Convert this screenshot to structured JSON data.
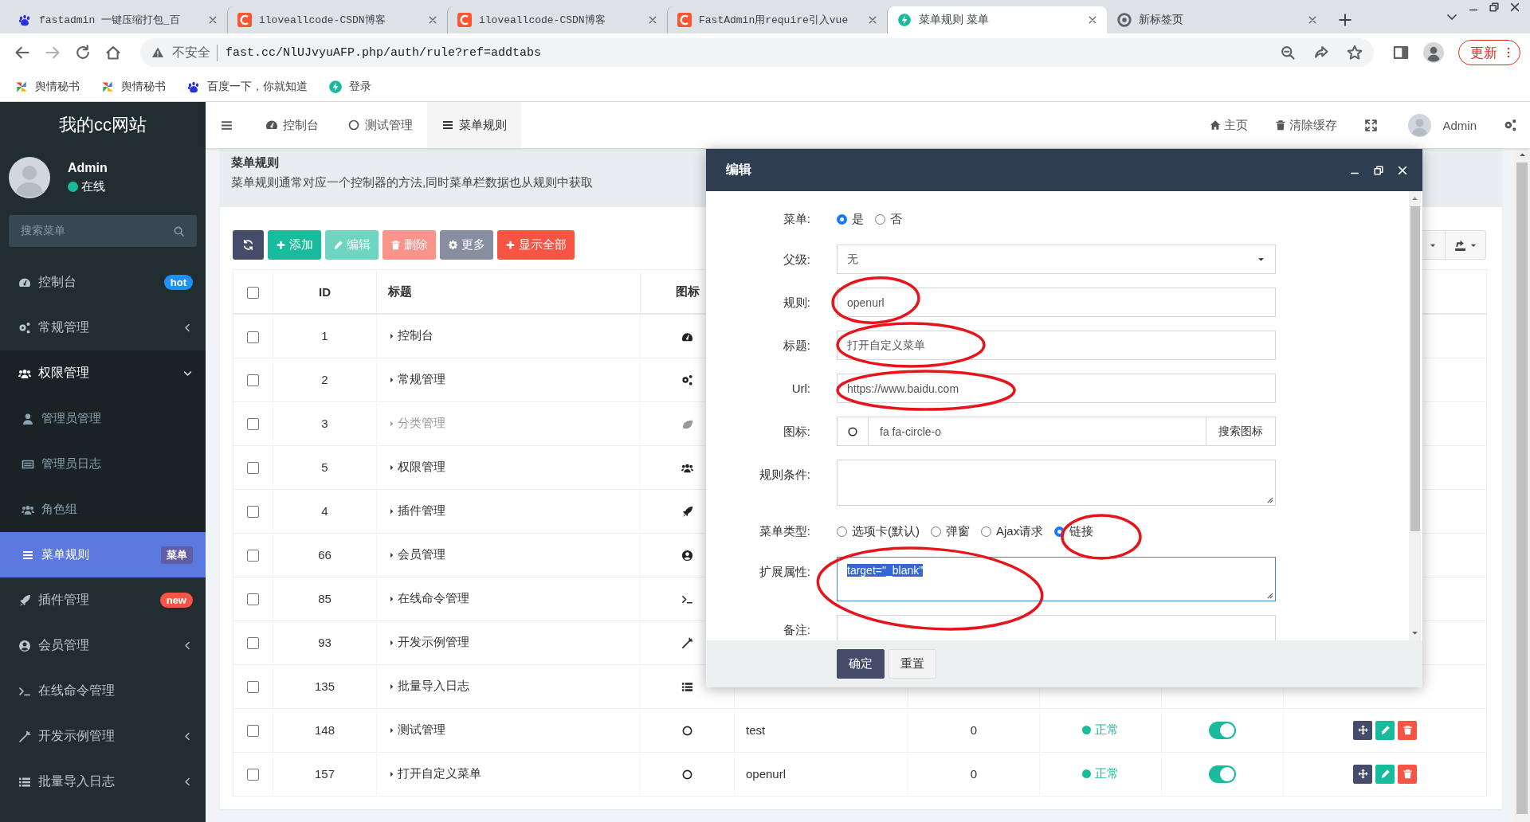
{
  "browser": {
    "tabs": [
      {
        "title": "fastadmin 一键压缩打包_百",
        "selected": false
      },
      {
        "title": "iloveallcode-CSDN博客",
        "selected": false
      },
      {
        "title": "iloveallcode-CSDN博客",
        "selected": false
      },
      {
        "title": "FastAdmin用require引入vue",
        "selected": false
      },
      {
        "title": "菜单规则 菜单",
        "selected": true
      },
      {
        "title": "新标签页",
        "selected": false
      }
    ],
    "security": "不安全",
    "url": "fast.cc/NlUJvyuAFP.php/auth/rule?ref=addtabs",
    "update_button": "更新",
    "bookmarks": [
      "舆情秘书",
      "舆情秘书",
      "百度一下，你就知道",
      "登录"
    ]
  },
  "sidebar": {
    "site_title": "我的cc网站",
    "user": {
      "name": "Admin",
      "status": "在线"
    },
    "search": {
      "placeholder": "搜索菜单"
    },
    "menu": [
      {
        "label": "控制台",
        "selected": false,
        "badge": {
          "text": "hot",
          "color": "#1e90ff"
        }
      },
      {
        "label": "常规管理",
        "selected": false,
        "expanded": false
      },
      {
        "label": "权限管理",
        "selected": false,
        "expanded": true,
        "children": [
          {
            "label": "管理员管理",
            "selected": false
          },
          {
            "label": "管理员日志",
            "selected": false
          },
          {
            "label": "角色组",
            "selected": false
          },
          {
            "label": "菜单规则",
            "selected": true,
            "badge": {
              "text": "菜单",
              "color": "#605ca8"
            }
          }
        ]
      },
      {
        "label": "插件管理",
        "selected": false,
        "badge": {
          "text": "new",
          "color": "#f75444"
        }
      },
      {
        "label": "会员管理",
        "selected": false,
        "expanded": false
      },
      {
        "label": "在线命令管理",
        "selected": false
      },
      {
        "label": "开发示例管理",
        "selected": false,
        "expanded": false
      },
      {
        "label": "批量导入日志",
        "selected": false,
        "expanded": false
      }
    ]
  },
  "navbar": {
    "tabs": [
      {
        "label": "控制台",
        "selected": false
      },
      {
        "label": "测试管理",
        "selected": false
      },
      {
        "label": "菜单规则",
        "selected": true
      }
    ],
    "links": [
      "主页",
      "清除缓存"
    ],
    "user": "Admin"
  },
  "page": {
    "title": "菜单规则",
    "description": "菜单规则通常对应一个控制器的方法,同时菜单栏数据也从规则中获取"
  },
  "toolbar": [
    {
      "kind": "refresh",
      "disabled": false
    },
    {
      "kind": "add",
      "label": "添加",
      "disabled": false
    },
    {
      "kind": "edit",
      "label": "编辑",
      "disabled": true
    },
    {
      "kind": "delete",
      "label": "删除",
      "disabled": true
    },
    {
      "kind": "more",
      "label": "更多",
      "disabled": false
    },
    {
      "kind": "show_all",
      "label": "显示全部",
      "disabled": false
    }
  ],
  "table": {
    "columns": [
      "ID",
      "标题",
      "图标"
    ],
    "header_checked": false,
    "rows": [
      {
        "id": "1",
        "title": "控制台",
        "muted": false,
        "checked": false
      },
      {
        "id": "2",
        "title": "常规管理",
        "muted": false,
        "checked": false
      },
      {
        "id": "3",
        "title": "分类管理",
        "muted": true,
        "checked": false
      },
      {
        "id": "5",
        "title": "权限管理",
        "muted": false,
        "checked": false
      },
      {
        "id": "4",
        "title": "插件管理",
        "muted": false,
        "checked": false
      },
      {
        "id": "66",
        "title": "会员管理",
        "muted": false,
        "checked": false
      },
      {
        "id": "85",
        "title": "在线命令管理",
        "muted": false,
        "checked": false
      },
      {
        "id": "93",
        "title": "开发示例管理",
        "muted": false,
        "checked": false
      },
      {
        "id": "135",
        "title": "批量导入日志",
        "muted": false,
        "checked": false
      },
      {
        "id": "148",
        "title": "测试管理",
        "muted": false,
        "checked": false,
        "rule": "test",
        "weigh": "0",
        "status": {
          "text": "正常",
          "color": "#18bc9c"
        },
        "on": true
      },
      {
        "id": "157",
        "title": "打开自定义菜单",
        "muted": false,
        "checked": false,
        "rule": "openurl",
        "weigh": "0",
        "status": {
          "text": "正常",
          "color": "#18bc9c"
        },
        "on": true
      }
    ]
  },
  "dialog": {
    "title": "编辑",
    "fields": [
      {
        "kind": "radio",
        "label": "菜单:",
        "options": [
          {
            "label": "是",
            "selected": true
          },
          {
            "label": "否",
            "selected": false
          }
        ]
      },
      {
        "kind": "select",
        "label": "父级:",
        "value": "无"
      },
      {
        "kind": "input",
        "label": "规则:",
        "value": "openurl"
      },
      {
        "kind": "input",
        "label": "标题:",
        "value": "打开自定义菜单"
      },
      {
        "kind": "input",
        "label": "Url:",
        "value": "https://www.baidu.com"
      },
      {
        "kind": "icon_input",
        "label": "图标:",
        "value": "fa fa-circle-o",
        "button": "搜索图标"
      },
      {
        "kind": "textarea",
        "label": "规则条件:",
        "focused": false
      },
      {
        "kind": "radio",
        "label": "菜单类型:",
        "options": [
          {
            "label": "选项卡(默认)",
            "selected": false
          },
          {
            "label": "弹窗",
            "selected": false
          },
          {
            "label": "Ajax请求",
            "selected": false
          },
          {
            "label": "链接",
            "selected": true
          }
        ]
      },
      {
        "kind": "textarea",
        "label": "扩展属性:",
        "value": "target=\"_blank\"",
        "focused": true
      },
      {
        "kind": "textarea",
        "label": "备注:",
        "focused": false
      }
    ],
    "buttons": [
      "确定",
      "重置"
    ]
  }
}
